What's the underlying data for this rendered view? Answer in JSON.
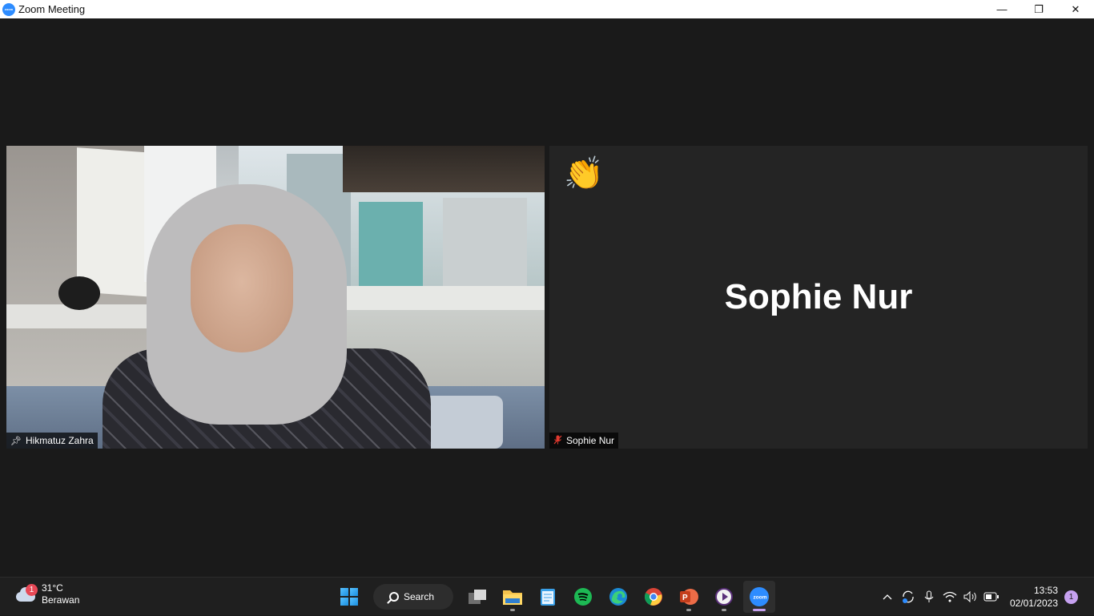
{
  "window": {
    "title": "Zoom Meeting",
    "app_icon_text": "zoom",
    "minimize": "—",
    "restore": "❐",
    "close": "✕"
  },
  "participants": [
    {
      "name": "Hikmatuz Zahra",
      "pinned": true,
      "video_on": true
    },
    {
      "name": "Sophie Nur",
      "muted": true,
      "video_on": false,
      "reaction": "👏"
    }
  ],
  "taskbar": {
    "weather": {
      "temp": "31°C",
      "condition": "Berawan",
      "badge": "1"
    },
    "search_label": "Search",
    "apps": [
      "task-view",
      "file-explorer",
      "notepad",
      "spotify",
      "edge",
      "chrome",
      "powerpoint",
      "media-player",
      "zoom"
    ],
    "clock": {
      "time": "13:53",
      "date": "02/01/2023"
    },
    "notification_count": "1",
    "colors": {
      "spotify": "#1db954",
      "zoom": "#2d8cff",
      "powerpoint": "#c43e1c"
    }
  }
}
